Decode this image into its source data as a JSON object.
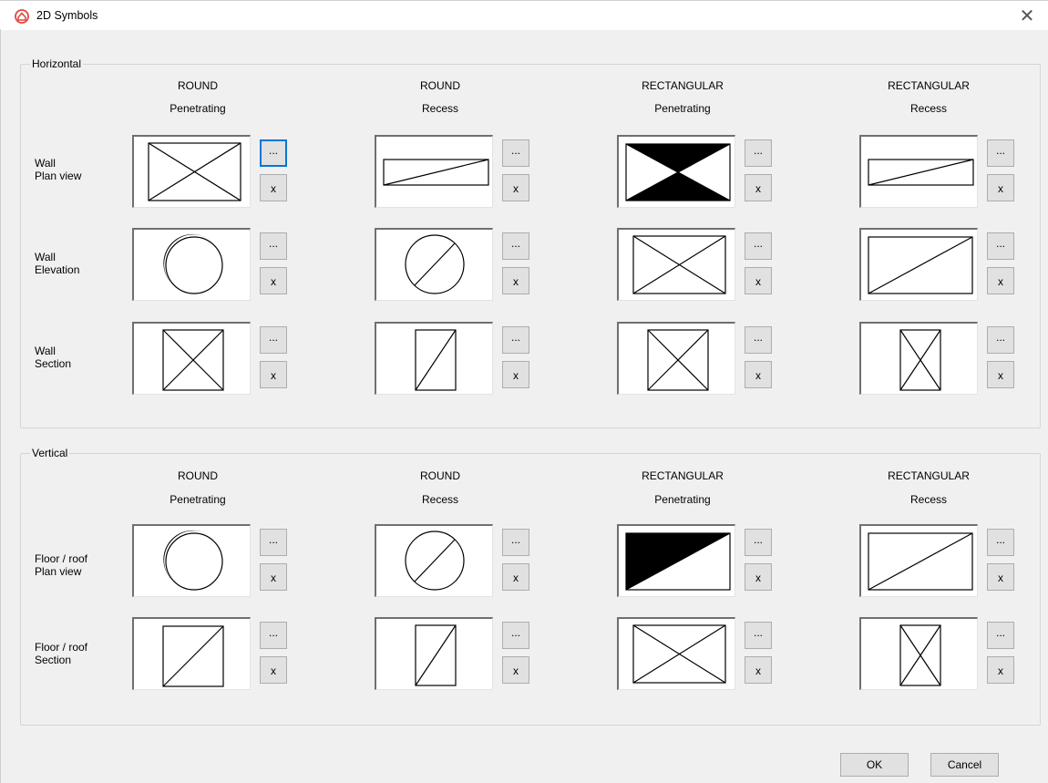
{
  "window": {
    "title": "2D Symbols",
    "close_glyph": "✕",
    "app_icon": "app-logo-icon",
    "accent_color": "#e0483e"
  },
  "buttons": {
    "browse_label": "...",
    "clear_label": "x",
    "ok_label": "OK",
    "cancel_label": "Cancel"
  },
  "groups": [
    {
      "legend": "Horizontal",
      "columns": [
        {
          "shape": "ROUND",
          "type": "Penetrating"
        },
        {
          "shape": "ROUND",
          "type": "Recess"
        },
        {
          "shape": "RECTANGULAR",
          "type": "Penetrating"
        },
        {
          "shape": "RECTANGULAR",
          "type": "Recess"
        }
      ],
      "rows": [
        {
          "label": "Wall\nPlan view",
          "symbols": [
            "rect-x",
            "rect-diag-thin",
            "bowtie-filled",
            "rect-diag-thin"
          ]
        },
        {
          "label": "Wall\nElevation",
          "symbols": [
            "circle-crescent",
            "circle-diag",
            "rect-x",
            "rect-diag"
          ]
        },
        {
          "label": "Wall\nSection",
          "symbols": [
            "square-x",
            "narrow-diag",
            "square-x",
            "narrow-x"
          ]
        }
      ]
    },
    {
      "legend": "Vertical",
      "columns": [
        {
          "shape": "ROUND",
          "type": "Penetrating"
        },
        {
          "shape": "ROUND",
          "type": "Recess"
        },
        {
          "shape": "RECTANGULAR",
          "type": "Penetrating"
        },
        {
          "shape": "RECTANGULAR",
          "type": "Recess"
        }
      ],
      "rows": [
        {
          "label": "Floor / roof\nPlan view",
          "symbols": [
            "circle-crescent",
            "circle-diag",
            "rect-half-filled",
            "rect-diag"
          ]
        },
        {
          "label": "Floor / roof\nSection",
          "symbols": [
            "square-diag",
            "narrow-diag",
            "rect-x",
            "narrow-x"
          ]
        }
      ]
    }
  ]
}
